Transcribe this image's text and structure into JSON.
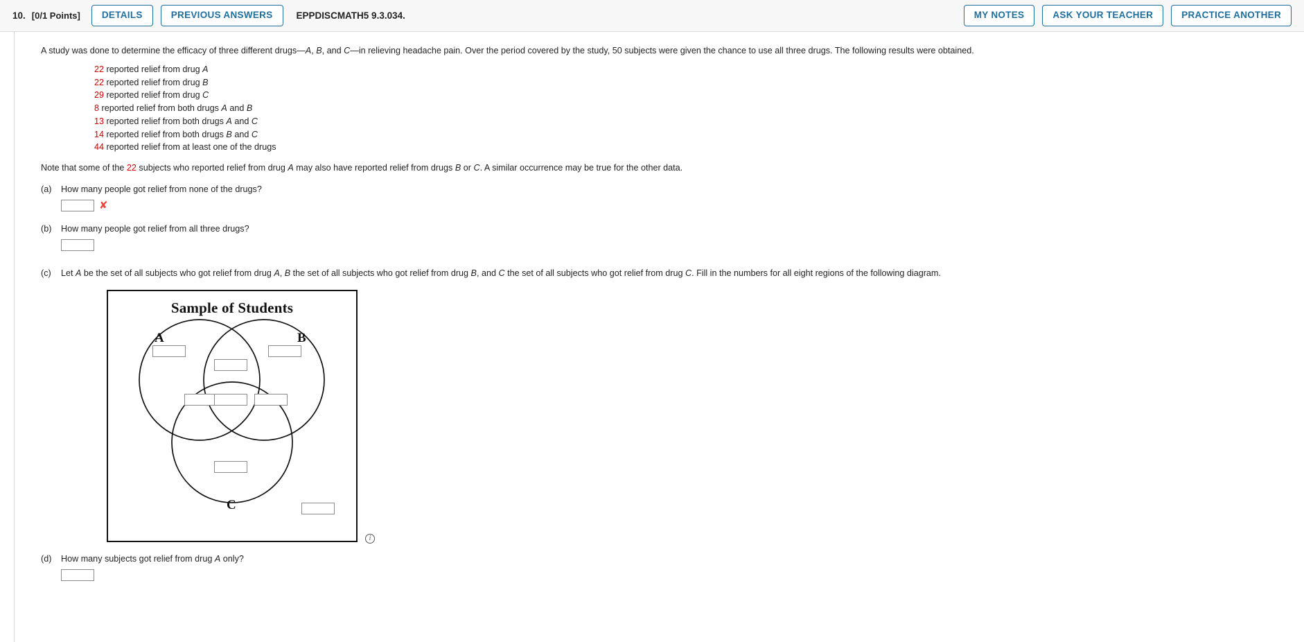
{
  "header": {
    "question_number": "10.",
    "points": "[0/1 Points]",
    "details_label": "DETAILS",
    "previous_answers_label": "PREVIOUS ANSWERS",
    "question_code": "EPPDISCMATH5 9.3.034.",
    "my_notes_label": "MY NOTES",
    "ask_your_teacher_label": "ASK YOUR TEACHER",
    "practice_another_label": "PRACTICE ANOTHER",
    "accent_color": "#1f6f9e",
    "background_color": "#f7f7f7"
  },
  "problem": {
    "intro_part1": "A study was done to determine the efficacy of three different drugs—",
    "intro_A": "A",
    "intro_comma1": ", ",
    "intro_B": "B",
    "intro_and": ", and ",
    "intro_C": "C",
    "intro_part2": "—in relieving headache pain. Over the period covered by the study, 50 subjects were given the chance to use all three drugs. The following results were obtained.",
    "facts": [
      {
        "count": "22",
        "text_before": " reported relief from drug ",
        "var1": "A",
        "text_mid": "",
        "var2": ""
      },
      {
        "count": "22",
        "text_before": " reported relief from drug ",
        "var1": "B",
        "text_mid": "",
        "var2": ""
      },
      {
        "count": "29",
        "text_before": " reported relief from drug ",
        "var1": "C",
        "text_mid": "",
        "var2": ""
      },
      {
        "count": "8",
        "text_before": " reported relief from both drugs ",
        "var1": "A",
        "text_mid": " and ",
        "var2": "B"
      },
      {
        "count": "13",
        "text_before": " reported relief from both drugs ",
        "var1": "A",
        "text_mid": " and ",
        "var2": "C"
      },
      {
        "count": "14",
        "text_before": " reported relief from both drugs ",
        "var1": "B",
        "text_mid": " and ",
        "var2": "C"
      },
      {
        "count": "44",
        "text_before": " reported relief from at least one of the drugs",
        "var1": "",
        "text_mid": "",
        "var2": ""
      }
    ],
    "note_1": "Note that some of the ",
    "note_num": "22",
    "note_2": " subjects who reported relief from drug ",
    "note_varA": "A",
    "note_3": " may also have reported relief from drugs ",
    "note_varB": "B",
    "note_4": " or ",
    "note_varC": "C",
    "note_5": ". A similar occurrence may be true for the other data.",
    "number_color": "#cc0000"
  },
  "parts": {
    "a": {
      "label": "(a)",
      "question": "How many people got relief from none of the drugs?",
      "answer_value": "",
      "status_icon": "incorrect-x-icon",
      "status_symbol": "✘",
      "status_color": "#e8473f"
    },
    "b": {
      "label": "(b)",
      "question": "How many people got relief from all three drugs?",
      "answer_value": ""
    },
    "c": {
      "label": "(c)",
      "q_1": "Let ",
      "q_A": "A",
      "q_2": " be the set of all subjects who got relief from drug ",
      "q_A2": "A",
      "q_3": ", ",
      "q_B": "B",
      "q_4": " the set of all subjects who got relief from drug ",
      "q_B2": "B",
      "q_5": ", and ",
      "q_C": "C",
      "q_6": " the set of all subjects who got relief from drug ",
      "q_C2": "C",
      "q_7": ". Fill in the numbers for all eight regions of the following diagram."
    },
    "d": {
      "label": "(d)",
      "q_1": "How many subjects got relief from drug ",
      "q_A": "A",
      "q_2": " only?",
      "answer_value": ""
    }
  },
  "venn": {
    "title": "Sample of Students",
    "set_labels": {
      "A": "A",
      "B": "B",
      "C": "C"
    },
    "regions": [
      {
        "name": "A-only",
        "value": ""
      },
      {
        "name": "A-and-B-only",
        "value": ""
      },
      {
        "name": "B-only",
        "value": ""
      },
      {
        "name": "A-and-C-only",
        "value": ""
      },
      {
        "name": "A-B-C",
        "value": ""
      },
      {
        "name": "B-and-C-only",
        "value": ""
      },
      {
        "name": "C-only",
        "value": ""
      },
      {
        "name": "outside-all",
        "value": ""
      }
    ],
    "info_symbol": "i"
  }
}
